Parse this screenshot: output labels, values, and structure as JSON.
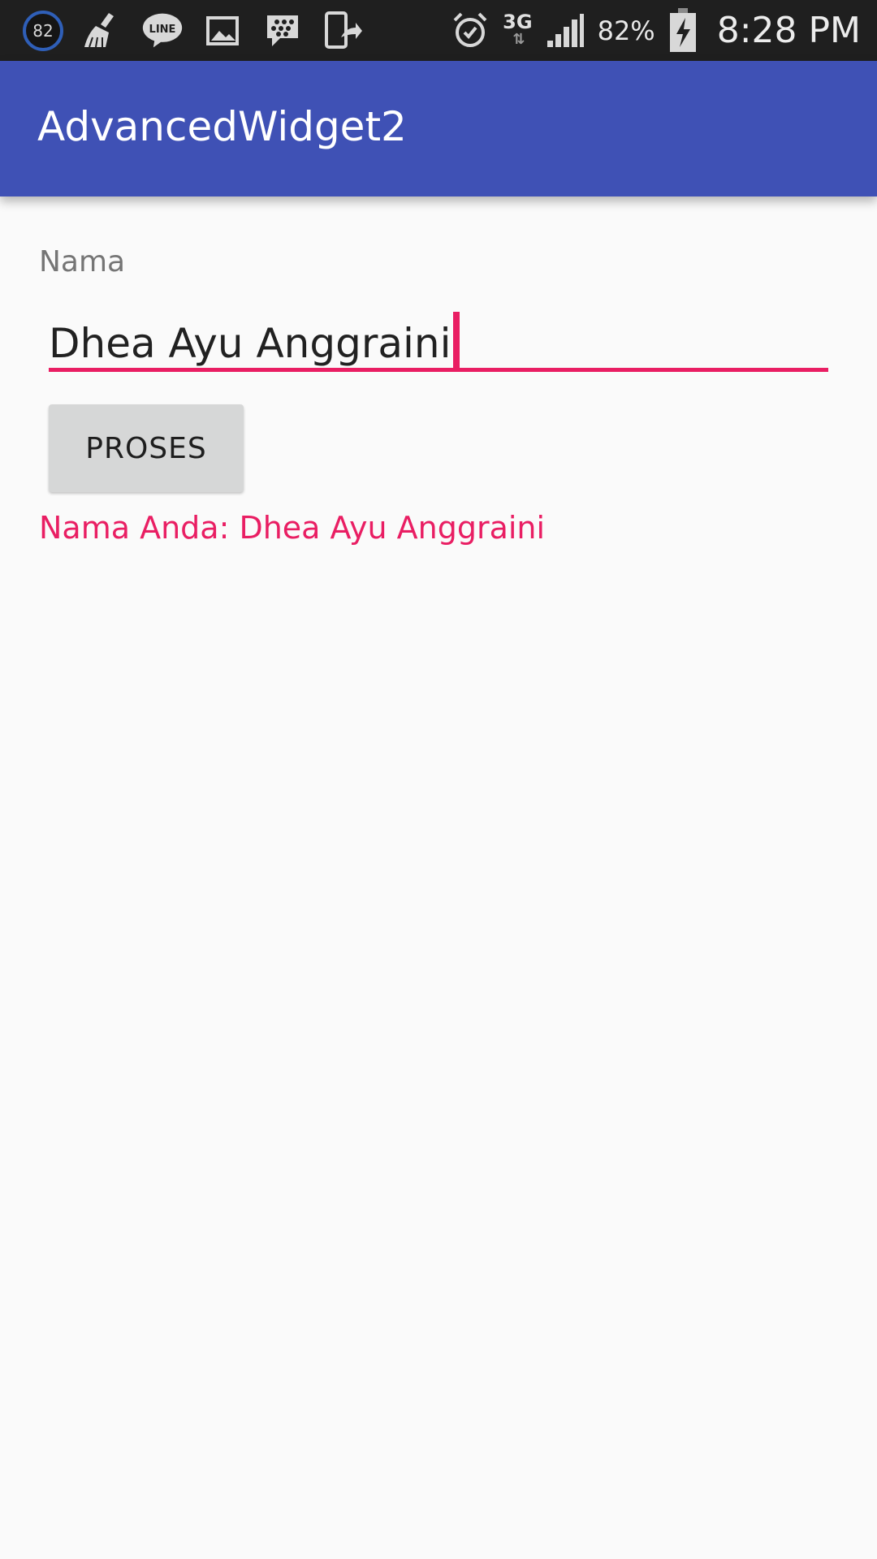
{
  "status_bar": {
    "cleaner_badge": "82",
    "notification_icons": [
      "cleaner-badge-icon",
      "broom-icon",
      "line-icon",
      "gallery-icon",
      "bbm-icon",
      "share-device-icon"
    ],
    "alarm_icon": "alarm-clock-icon",
    "network": "3G",
    "network_arrows": "⇅",
    "signal_icon": "signal-bars-icon",
    "battery_percent": "82%",
    "battery_icon": "battery-charging-icon",
    "time": "8:28 PM"
  },
  "app_bar": {
    "title": "AdvancedWidget2",
    "color": "#3f51b5"
  },
  "form": {
    "name_label": "Nama",
    "name_value": "Dhea Ayu Anggraini",
    "accent_color": "#e91e63",
    "submit_label": "PROSES"
  },
  "result": {
    "text": "Nama Anda: Dhea Ayu Anggraini"
  }
}
